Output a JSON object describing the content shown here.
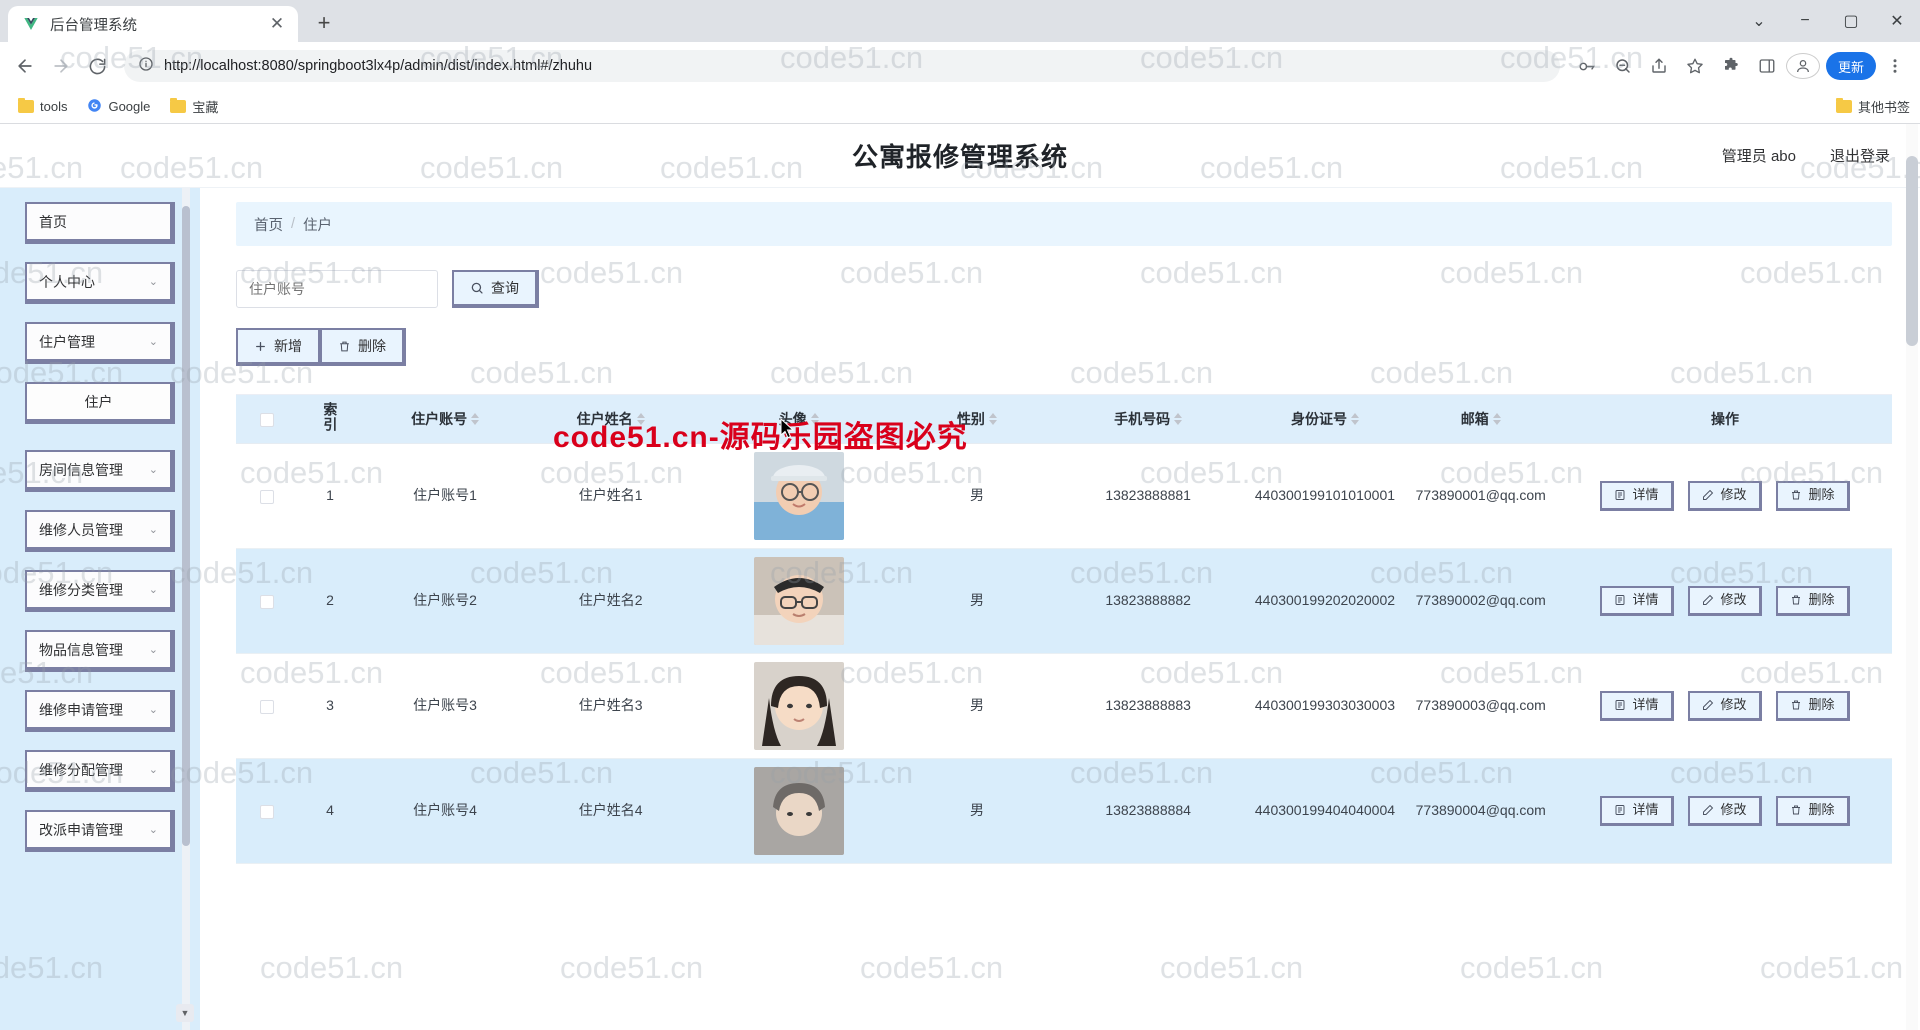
{
  "browser": {
    "tab_title": "后台管理系统",
    "tab_favicon": "vue-logo-icon",
    "new_tab_label": "+",
    "url": "http://localhost:8080/springboot3lx4p/admin/dist/index.html#/zhuhu",
    "back_icon": "back-arrow-icon",
    "forward_icon": "forward-arrow-icon",
    "reload_icon": "reload-icon",
    "info_icon": "page-info-icon",
    "update_button": "更新",
    "bookmarks": [
      {
        "label": "tools",
        "icon": "folder-icon"
      },
      {
        "label": "Google",
        "icon": "google-icon"
      },
      {
        "label": "宝藏",
        "icon": "folder-icon"
      }
    ],
    "other_bookmarks": "其他书签",
    "window_minimize": "−",
    "window_maximize": "▢",
    "window_close": "✕",
    "window_chevron": "⌄"
  },
  "app": {
    "title": "公寓报修管理系统",
    "admin_label": "管理员 abo",
    "logout_label": "退出登录"
  },
  "sidebar": {
    "items": [
      {
        "label": "首页",
        "expandable": false,
        "sub": false
      },
      {
        "label": "个人中心",
        "expandable": true,
        "sub": false
      },
      {
        "label": "住户管理",
        "expandable": true,
        "sub": false
      },
      {
        "label": "住户",
        "expandable": false,
        "sub": true
      },
      {
        "label": "房间信息管理",
        "expandable": true,
        "sub": false
      },
      {
        "label": "维修人员管理",
        "expandable": true,
        "sub": false
      },
      {
        "label": "维修分类管理",
        "expandable": true,
        "sub": false
      },
      {
        "label": "物品信息管理",
        "expandable": true,
        "sub": false
      },
      {
        "label": "维修申请管理",
        "expandable": true,
        "sub": false
      },
      {
        "label": "维修分配管理",
        "expandable": true,
        "sub": false
      },
      {
        "label": "改派申请管理",
        "expandable": true,
        "sub": false
      }
    ],
    "chevron": "⌄",
    "scroll_down_arrow": "▼"
  },
  "breadcrumb": {
    "root": "首页",
    "separator": "/",
    "current": "住户"
  },
  "search": {
    "placeholder": "住户账号",
    "value": "",
    "button_label": "查询",
    "button_icon": "search-icon"
  },
  "toolbar": {
    "add_label": "新增",
    "add_icon": "plus-icon",
    "delete_label": "删除",
    "delete_icon": "trash-icon"
  },
  "table": {
    "columns": [
      {
        "label": "",
        "name": "select-all-checkbox",
        "sortable": false
      },
      {
        "label": "索引",
        "name": "index",
        "sortable": false,
        "vertical": true
      },
      {
        "label": "住户账号",
        "name": "account",
        "sortable": true
      },
      {
        "label": "住户姓名",
        "name": "name",
        "sortable": true
      },
      {
        "label": "头像",
        "name": "avatar",
        "sortable": true
      },
      {
        "label": "性别",
        "name": "gender",
        "sortable": true
      },
      {
        "label": "手机号码",
        "name": "phone",
        "sortable": true
      },
      {
        "label": "身份证号",
        "name": "idcard",
        "sortable": true
      },
      {
        "label": "邮箱",
        "name": "email",
        "sortable": true
      },
      {
        "label": "操作",
        "name": "operations",
        "sortable": false
      }
    ],
    "row_actions": [
      {
        "label": "详情",
        "icon": "detail-icon"
      },
      {
        "label": "修改",
        "icon": "edit-icon"
      },
      {
        "label": "删除",
        "icon": "trash-icon"
      }
    ],
    "rows": [
      {
        "index": "1",
        "account": "住户账号1",
        "name": "住户姓名1",
        "avatar": "avatar-woman-cap",
        "gender": "男",
        "phone": "13823888881",
        "idcard": "440300199101010001",
        "email": "773890001@qq.com"
      },
      {
        "index": "2",
        "account": "住户账号2",
        "name": "住户姓名2",
        "avatar": "avatar-man-glasses",
        "gender": "男",
        "phone": "13823888882",
        "idcard": "440300199202020002",
        "email": "773890002@qq.com"
      },
      {
        "index": "3",
        "account": "住户账号3",
        "name": "住户姓名3",
        "avatar": "avatar-woman-dark-hair",
        "gender": "男",
        "phone": "13823888883",
        "idcard": "440300199303030003",
        "email": "773890003@qq.com"
      },
      {
        "index": "4",
        "account": "住户账号4",
        "name": "住户姓名4",
        "avatar": "avatar-person-grey",
        "gender": "男",
        "phone": "13823888884",
        "idcard": "440300199404040004",
        "email": "773890004@qq.com"
      }
    ]
  },
  "watermark": {
    "tile_text": "code51.cn",
    "red_text": "code51.cn-源码乐园盗图必究"
  },
  "colors": {
    "sidebar_bg": "#d9edfb",
    "accent_blue": "#e9f4fe",
    "border_dark": "#7b7fa3",
    "breadcrumb_bg": "#e9f5fe",
    "header_bg": "#ddeefb",
    "row_alt_bg": "#d9edfb",
    "update_blue": "#1a73e8",
    "watermark_red": "#d9001b"
  }
}
